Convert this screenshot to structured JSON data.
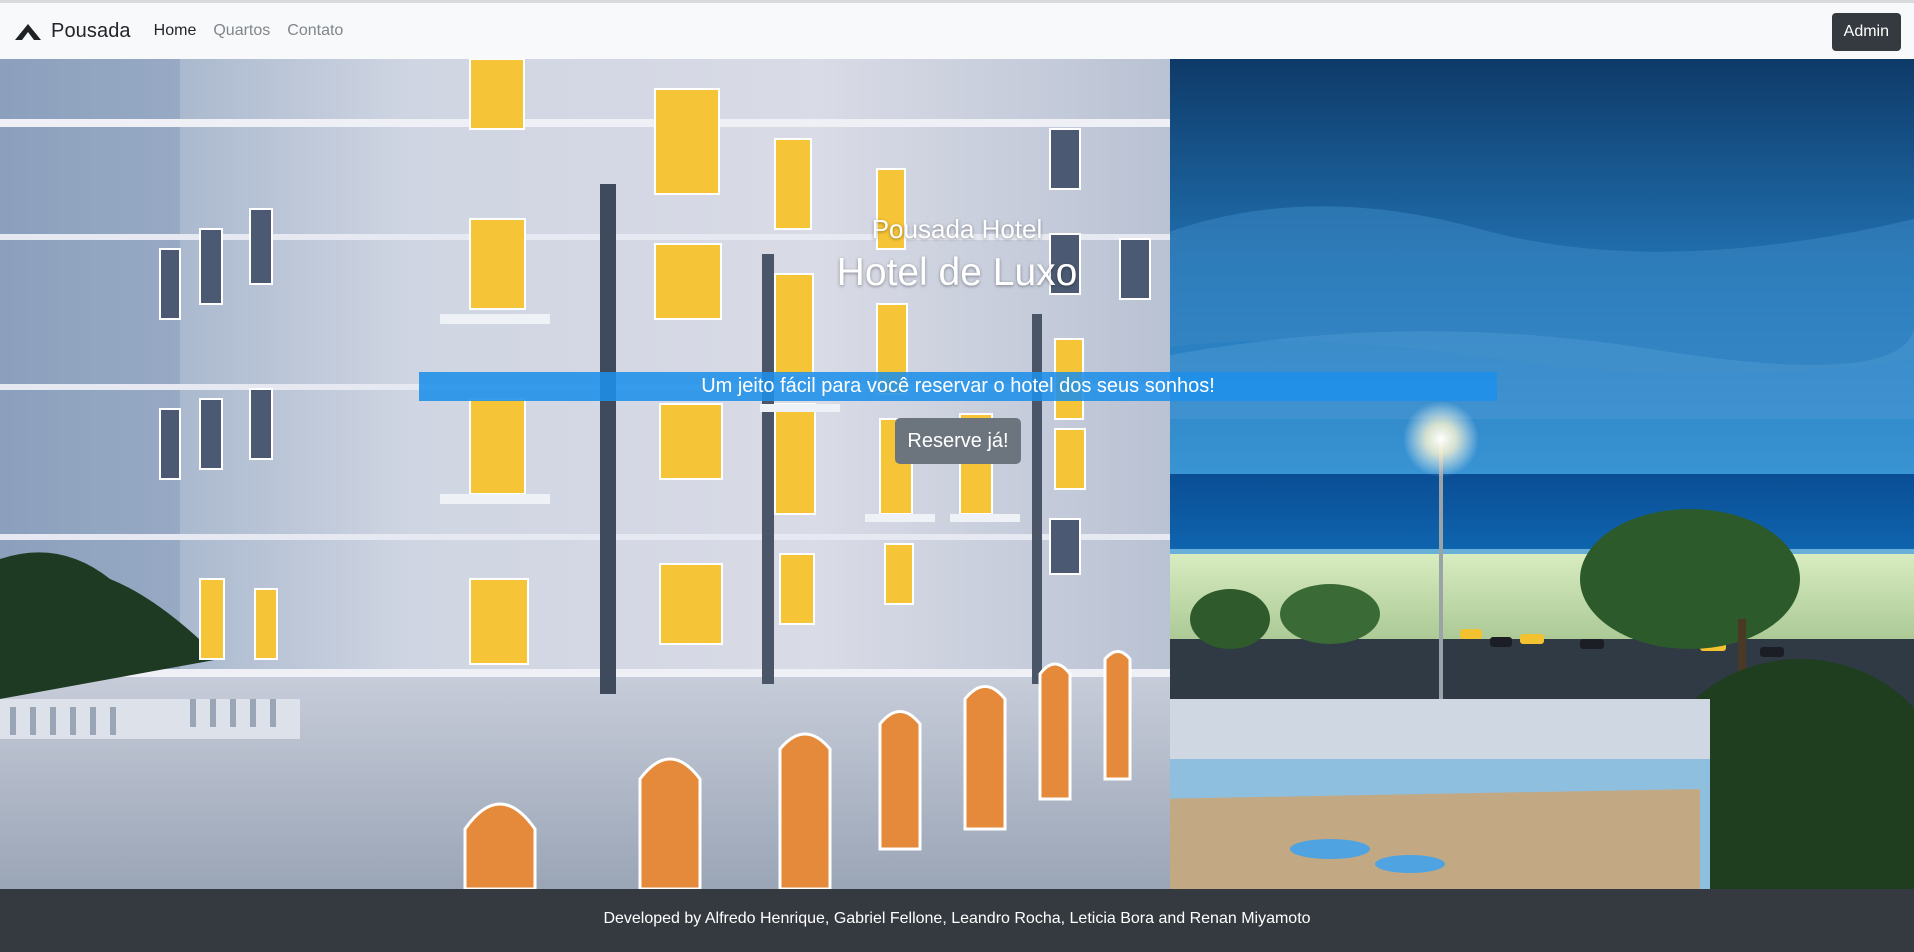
{
  "nav": {
    "brand": "Pousada",
    "links": [
      {
        "label": "Home",
        "active": true
      },
      {
        "label": "Quartos",
        "active": false
      },
      {
        "label": "Contato",
        "active": false
      }
    ],
    "admin_label": "Admin"
  },
  "hero": {
    "subtitle": "Pousada Hotel",
    "title": "Hotel de Luxo",
    "tagline": "Um jeito fácil para você reservar o hotel dos seus sonhos!",
    "cta_label": "Reserve já!"
  },
  "footer": {
    "credits": "Developed by Alfredo Henrique, Gabriel Fellone, Leandro Rocha, Leticia Bora and Renan Miyamoto"
  },
  "colors": {
    "navbar_bg": "#f8f9fa",
    "dark": "#343a40",
    "tagline_bg": "#1e90e9",
    "cta_bg": "#6c757d"
  }
}
